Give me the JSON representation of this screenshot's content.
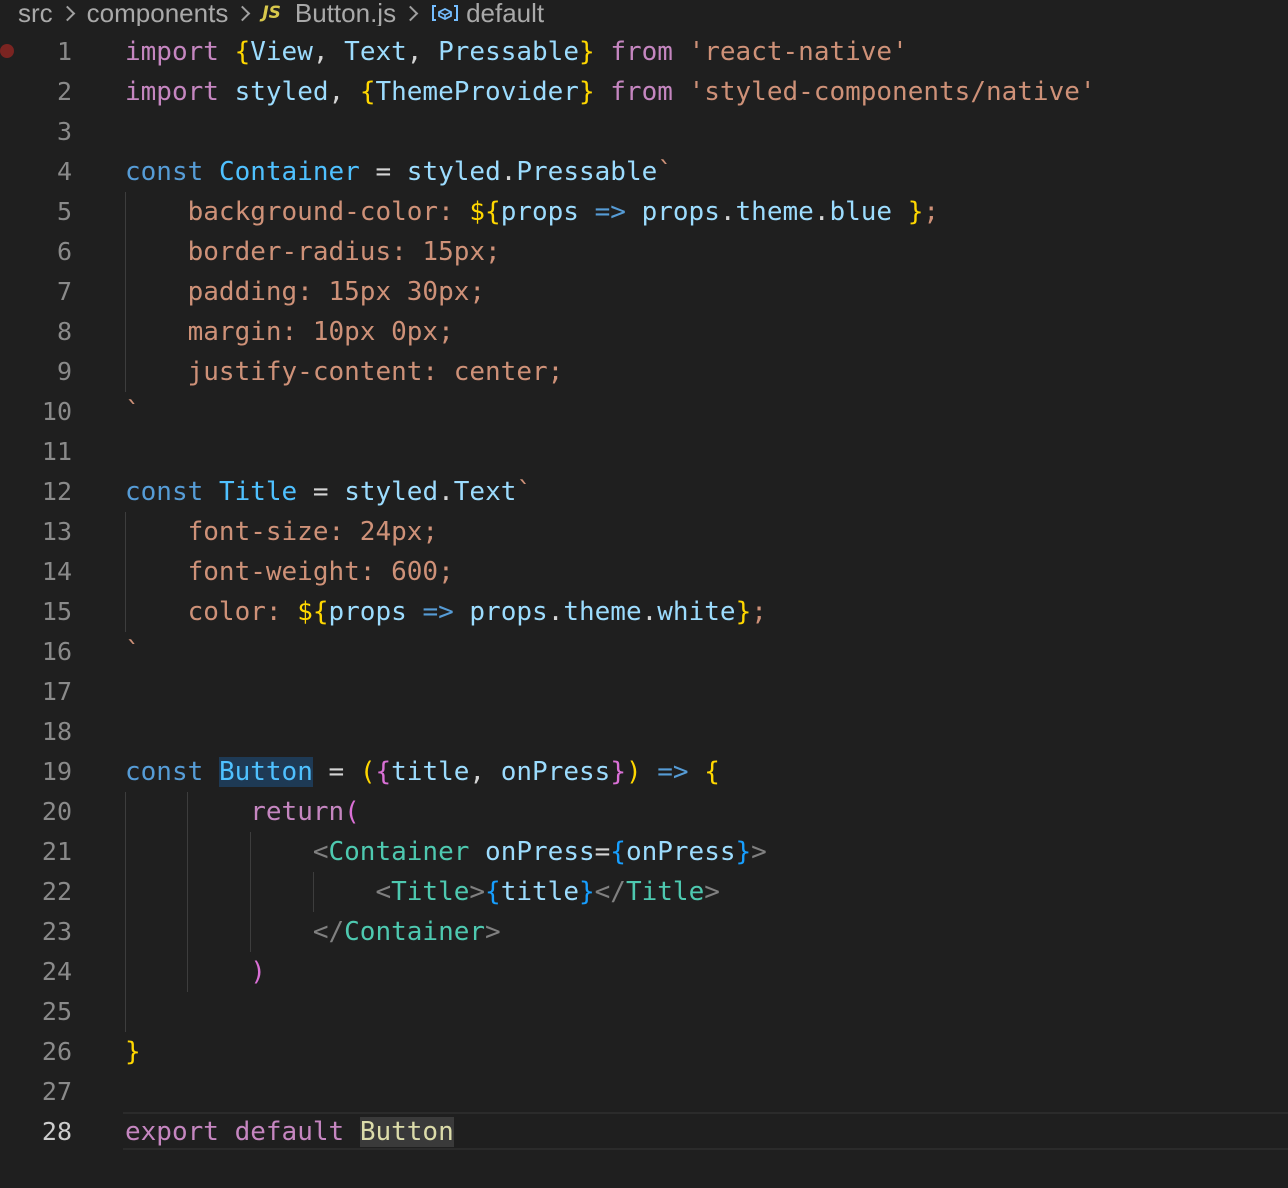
{
  "breadcrumb": {
    "items": [
      {
        "label": "src"
      },
      {
        "label": "components"
      },
      {
        "label": "Button.js",
        "icon": "JS"
      },
      {
        "label": "default",
        "icon": "symbol-variable-icon"
      }
    ]
  },
  "editor": {
    "active_line": 28,
    "breakpoint_line": 1,
    "lines": [
      {
        "n": "1"
      },
      {
        "n": "2"
      },
      {
        "n": "3"
      },
      {
        "n": "4"
      },
      {
        "n": "5"
      },
      {
        "n": "6"
      },
      {
        "n": "7"
      },
      {
        "n": "8"
      },
      {
        "n": "9"
      },
      {
        "n": "10"
      },
      {
        "n": "11"
      },
      {
        "n": "12"
      },
      {
        "n": "13"
      },
      {
        "n": "14"
      },
      {
        "n": "15"
      },
      {
        "n": "16"
      },
      {
        "n": "17"
      },
      {
        "n": "18"
      },
      {
        "n": "19"
      },
      {
        "n": "20"
      },
      {
        "n": "21"
      },
      {
        "n": "22"
      },
      {
        "n": "23"
      },
      {
        "n": "24"
      },
      {
        "n": "25"
      },
      {
        "n": "26"
      },
      {
        "n": "27"
      },
      {
        "n": "28"
      }
    ],
    "tokens": {
      "l1": [
        "import",
        " ",
        "{",
        "View",
        ", ",
        "Text",
        ", ",
        "Pressable",
        "}",
        " ",
        "from",
        " ",
        "'react-native'"
      ],
      "l2": [
        "import",
        " ",
        "styled",
        ", ",
        "{",
        "ThemeProvider",
        "}",
        " ",
        "from",
        " ",
        "'styled-components/native'"
      ],
      "l4": [
        "const",
        " ",
        "Container",
        " = ",
        "styled",
        ".",
        "Pressable",
        "`"
      ],
      "l5": [
        "    background-color: ",
        "${",
        "props",
        " ",
        "=>",
        " ",
        "props",
        ".",
        "theme",
        ".",
        "blue",
        " ",
        "}",
        ";"
      ],
      "l6": [
        "    border-radius: 15px;"
      ],
      "l7": [
        "    padding: 15px 30px;"
      ],
      "l8": [
        "    margin: 10px 0px;"
      ],
      "l9": [
        "    justify-content: center;"
      ],
      "l10": [
        "`"
      ],
      "l12": [
        "const",
        " ",
        "Title",
        " = ",
        "styled",
        ".",
        "Text",
        "`"
      ],
      "l13": [
        "    font-size: 24px;"
      ],
      "l14": [
        "    font-weight: 600;"
      ],
      "l15": [
        "    color: ",
        "${",
        "props",
        " ",
        "=>",
        " ",
        "props",
        ".",
        "theme",
        ".",
        "white",
        "}",
        ";"
      ],
      "l16": [
        "`"
      ],
      "l19": [
        "const",
        " ",
        "Button",
        " = ",
        "(",
        "{",
        "title",
        ", ",
        "onPress",
        "}",
        ")",
        " ",
        "=>",
        " ",
        "{"
      ],
      "l20": [
        "        ",
        "return",
        "("
      ],
      "l21": [
        "            ",
        "<",
        "Container",
        " ",
        "onPress",
        "=",
        "{",
        "onPress",
        "}",
        ">"
      ],
      "l22": [
        "                ",
        "<",
        "Title",
        ">",
        "{",
        "title",
        "}",
        "</",
        "Title",
        ">"
      ],
      "l23": [
        "            ",
        "</",
        "Container",
        ">"
      ],
      "l24": [
        "        ",
        ")"
      ],
      "l26": [
        "}"
      ],
      "l28": [
        "export",
        " ",
        "default",
        " ",
        "Button"
      ]
    }
  }
}
